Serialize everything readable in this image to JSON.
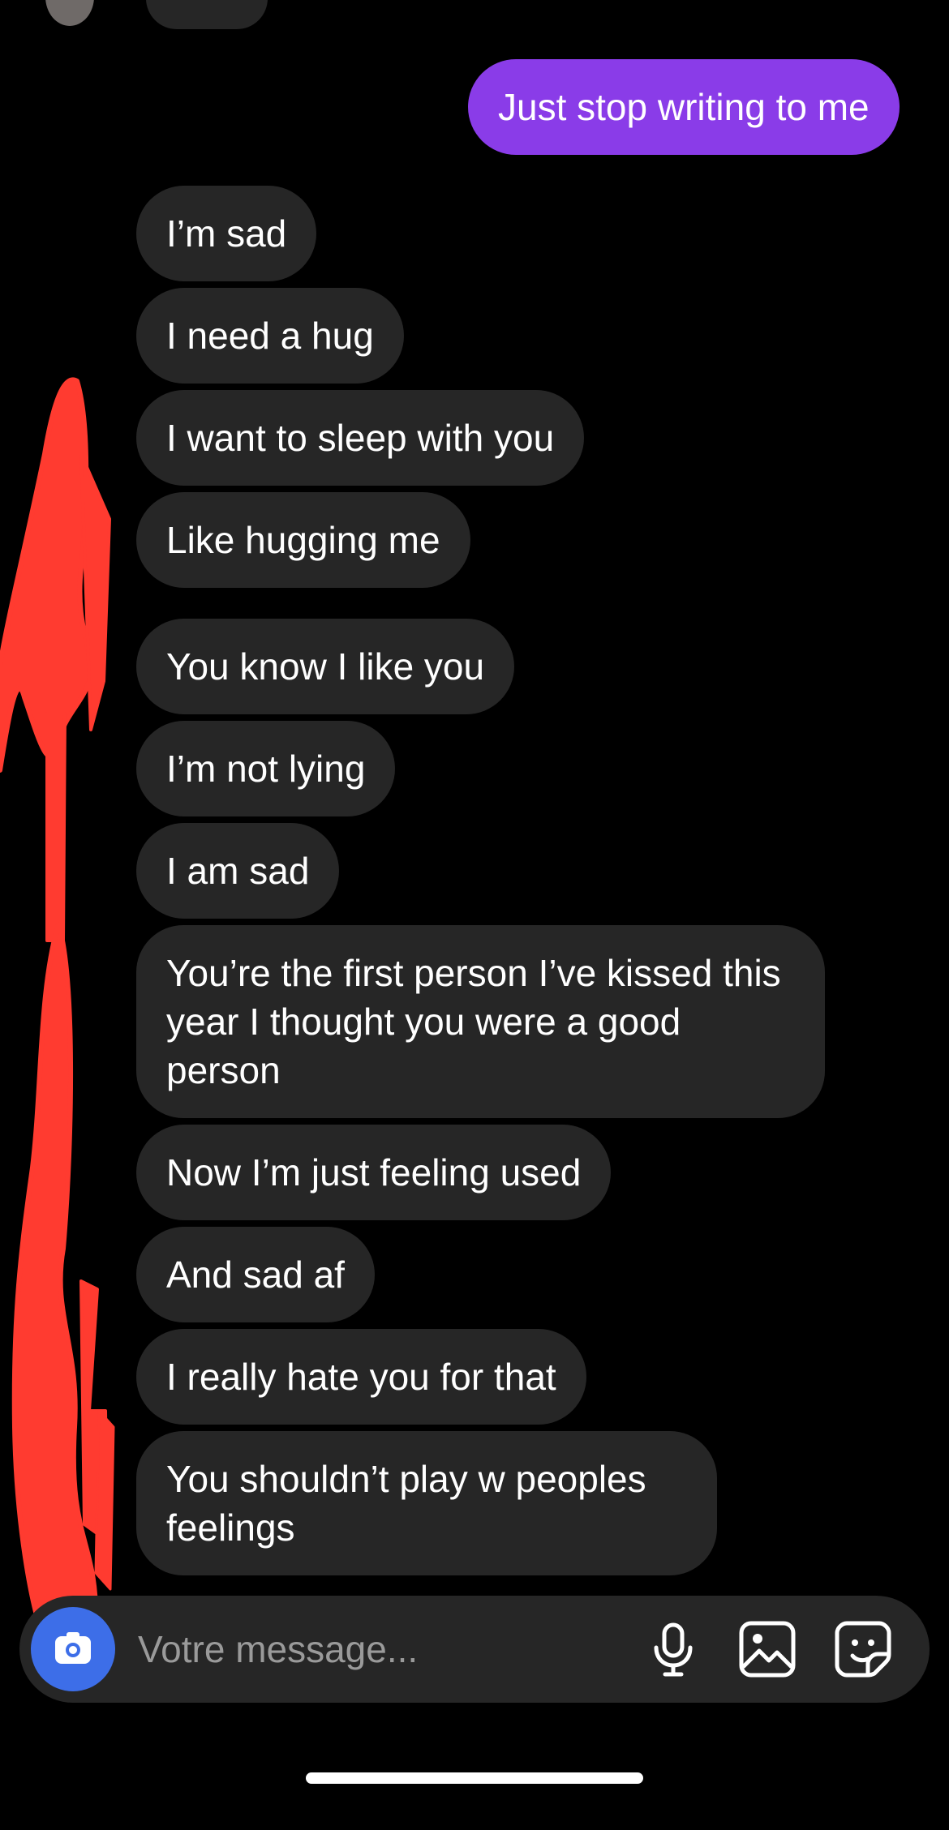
{
  "thread": {
    "messages": [
      {
        "sender": "me",
        "text": "Just stop writing to me"
      },
      {
        "sender": "them",
        "text": "I’m sad"
      },
      {
        "sender": "them",
        "text": "I need a hug"
      },
      {
        "sender": "them",
        "text": "I want to sleep with you"
      },
      {
        "sender": "them",
        "text": "Like hugging me"
      },
      {
        "sender": "them",
        "text": "You know I like you"
      },
      {
        "sender": "them",
        "text": "I’m not lying"
      },
      {
        "sender": "them",
        "text": "I am sad"
      },
      {
        "sender": "them",
        "text": "You’re the first person I’ve kissed this year I thought you were a good person"
      },
      {
        "sender": "them",
        "text": "Now I’m just feeling used"
      },
      {
        "sender": "them",
        "text": "And sad af"
      },
      {
        "sender": "them",
        "text": "I really hate you for that"
      },
      {
        "sender": "them",
        "text": "You shouldn’t play w peoples feelings"
      }
    ]
  },
  "composer": {
    "placeholder": "Votre message...",
    "icons": [
      "camera-icon",
      "microphone-icon",
      "gallery-icon",
      "sticker-icon"
    ]
  },
  "colors": {
    "background": "#000000",
    "outgoing_bubble": "#8a3ce8",
    "incoming_bubble": "#262626",
    "camera_button": "#3d6ee8",
    "redaction_scribble": "#ff3b30"
  }
}
